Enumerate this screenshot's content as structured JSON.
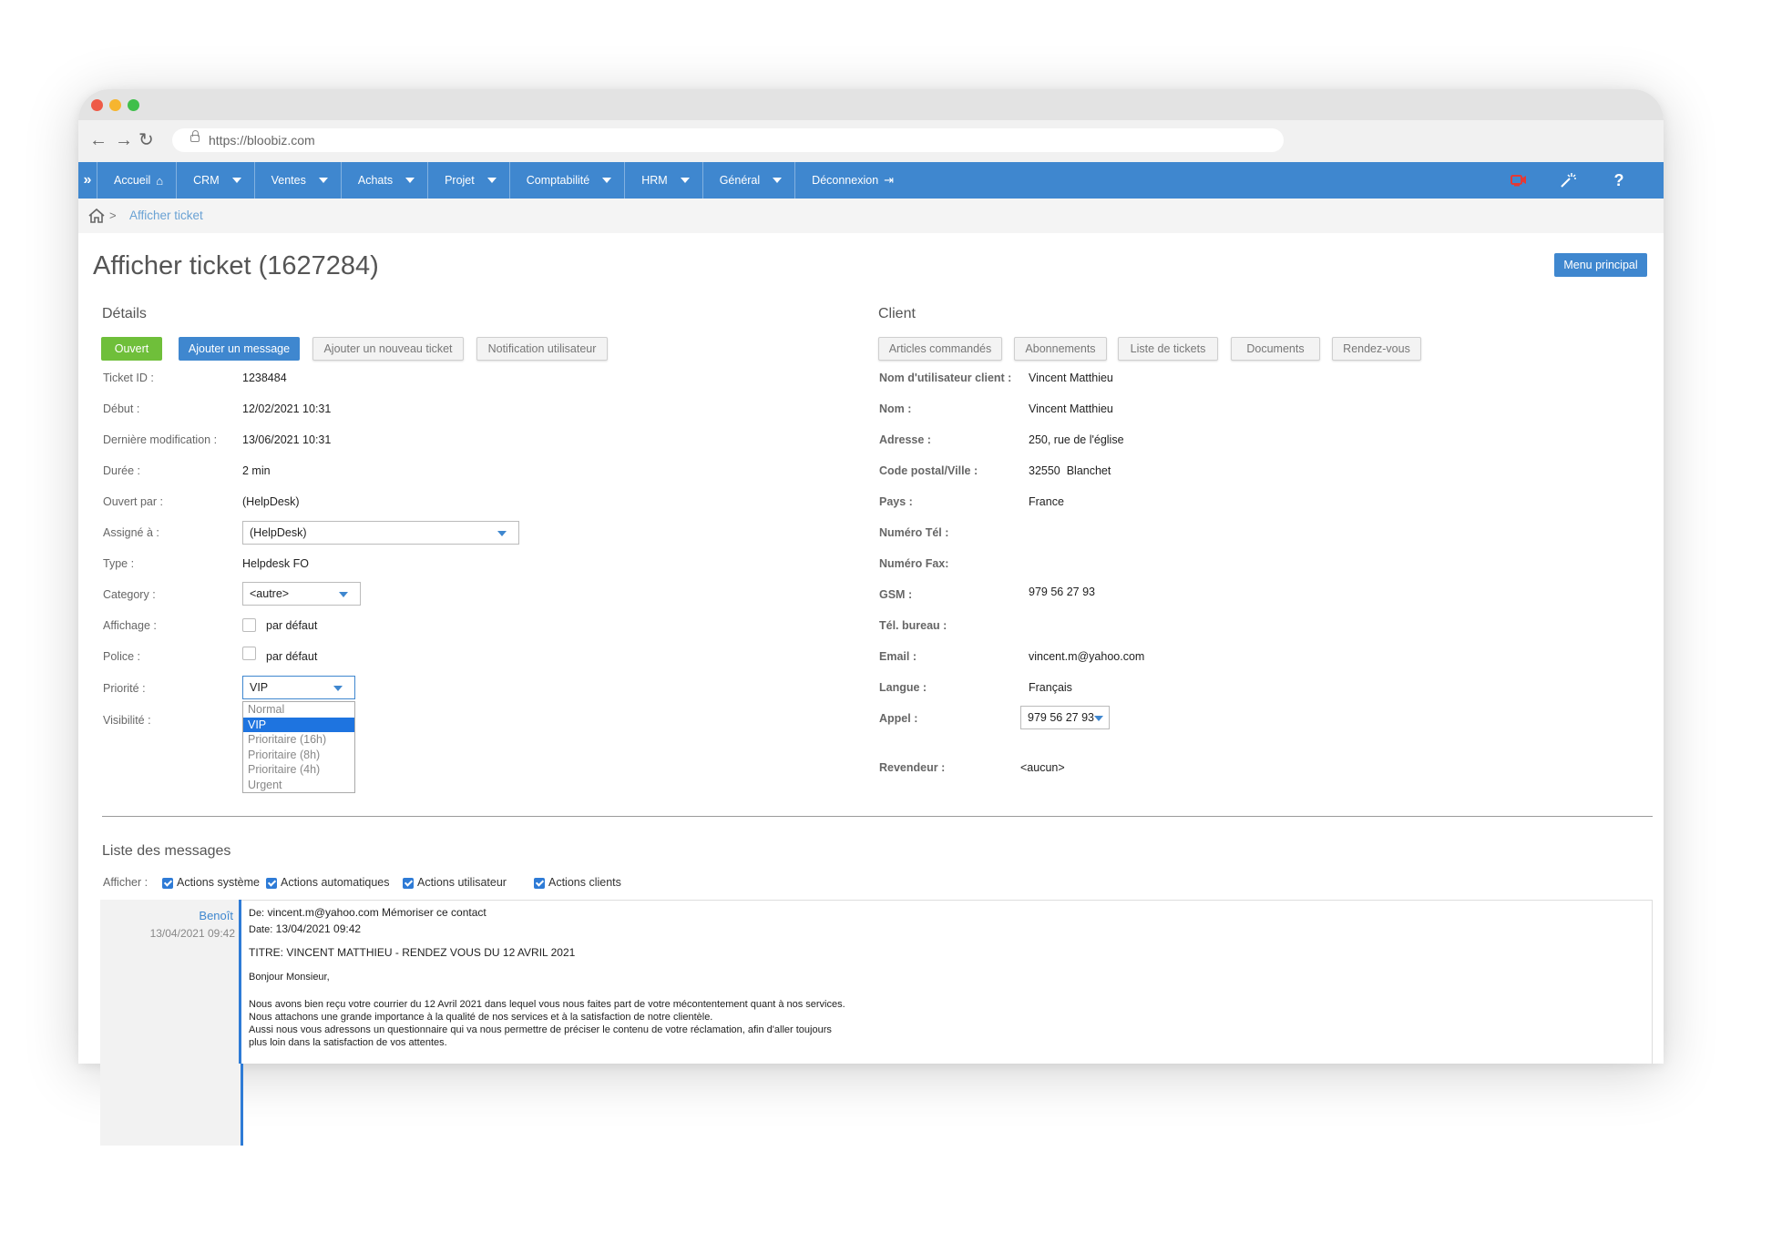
{
  "browser": {
    "url": "https://bloobiz.com",
    "nav": {
      "back": "←",
      "forward": "→",
      "reload": "↻"
    }
  },
  "menu": {
    "expand": "»",
    "items": [
      {
        "label": "Accueil",
        "icon": "home-icon",
        "caret": false
      },
      {
        "label": "CRM",
        "caret": true
      },
      {
        "label": "Ventes",
        "caret": true
      },
      {
        "label": "Achats",
        "caret": true
      },
      {
        "label": "Projet",
        "caret": true
      },
      {
        "label": "Comptabilité",
        "caret": true
      },
      {
        "label": "HRM",
        "caret": true
      },
      {
        "label": "Général",
        "caret": true
      },
      {
        "label": "Déconnexion",
        "icon": "logout-icon",
        "caret": false
      }
    ],
    "right_icons": [
      "video-call-icon",
      "magic-wand-icon",
      "help-icon"
    ],
    "help": "?"
  },
  "breadcrumb": {
    "current": "Afficher ticket",
    "separator": ">"
  },
  "page": {
    "title": "Afficher ticket (1627284)",
    "main_menu_button": "Menu principal"
  },
  "details": {
    "title": "Détails",
    "buttons": {
      "status": "Ouvert",
      "add_message": "Ajouter un message",
      "add_ticket": "Ajouter un nouveau ticket",
      "notify": "Notification utilisateur"
    },
    "fields": {
      "ticket_id": {
        "label": "Ticket ID :",
        "value": "1238484"
      },
      "debut": {
        "label": "Début :",
        "value": "12/02/2021 10:31"
      },
      "last_mod": {
        "label": "Dernière modification :",
        "value": "13/06/2021 10:31"
      },
      "duree": {
        "label": "Durée :",
        "value": "2 min"
      },
      "ouvert_par": {
        "label": "Ouvert par :",
        "value": "(HelpDesk)"
      },
      "assigne": {
        "label": "Assigné à :",
        "value": "(HelpDesk)"
      },
      "type": {
        "label": "Type :",
        "value": "Helpdesk FO"
      },
      "category": {
        "label": "Category :",
        "value": "<autre>"
      },
      "affichage": {
        "label": "Affichage :",
        "value": "par défaut",
        "checked": false
      },
      "police": {
        "label": "Police :",
        "value": "par défaut",
        "checked": false
      },
      "priorite": {
        "label": "Priorité :",
        "value": "VIP"
      },
      "visibilite": {
        "label": "Visibilité :"
      }
    },
    "priority_options": [
      "Normal",
      "VIP",
      "Prioritaire (16h)",
      "Prioritaire (8h)",
      "Prioritaire (4h)",
      "Urgent"
    ],
    "priority_selected": "VIP"
  },
  "client": {
    "title": "Client",
    "buttons": {
      "articles": "Articles commandés",
      "abonnements": "Abonnements",
      "tickets": "Liste de tickets",
      "documents": "Documents",
      "rdv": "Rendez-vous"
    },
    "fields": {
      "username": {
        "label": "Nom d'utilisateur client :",
        "value": "Vincent Matthieu"
      },
      "nom": {
        "label": "Nom :",
        "value": "Vincent Matthieu"
      },
      "adresse": {
        "label": "Adresse :",
        "value": "250, rue de l'église"
      },
      "cp_ville": {
        "label": "Code postal/Ville :",
        "value": "32550  Blanchet"
      },
      "pays": {
        "label": "Pays :",
        "value": "France"
      },
      "tel": {
        "label": "Numéro Tél :",
        "value": ""
      },
      "fax": {
        "label": "Numéro Fax:",
        "value": ""
      },
      "gsm": {
        "label": "GSM :",
        "value": "979 56 27 93"
      },
      "tel_bureau": {
        "label": "Tél. bureau :",
        "value": ""
      },
      "email": {
        "label": "Email :",
        "value": "vincent.m@yahoo.com"
      },
      "langue": {
        "label": "Langue :",
        "value": "Français"
      },
      "appel": {
        "label": "Appel :",
        "value": "979 56 27 93"
      },
      "revendeur": {
        "label": "Revendeur :",
        "value": "<aucun>"
      }
    }
  },
  "messages": {
    "title": "Liste des messages",
    "filter_label": "Afficher :",
    "filters": [
      {
        "label": "Actions système",
        "checked": true
      },
      {
        "label": "Actions automatiques",
        "checked": true
      },
      {
        "label": "Actions utilisateur",
        "checked": true
      },
      {
        "label": "Actions clients",
        "checked": true
      }
    ],
    "items": [
      {
        "author": "Benoît",
        "date": "13/04/2021 09:42",
        "from_label": "De:",
        "from": "vincent.m@yahoo.com Mémoriser ce contact",
        "date_label": "Date:",
        "date_value": "13/04/2021 09:42",
        "subject": "TITRE: VINCENT MATTHIEU - RENDEZ VOUS DU 12 AVRIL 2021",
        "greeting": "Bonjour Monsieur,",
        "body": [
          "Nous avons bien reçu votre courrier du 12 Avril 2021 dans lequel vous nous faites part de votre mécontentement quant à nos services.",
          "Nous attachons une grande importance à la qualité de nos services et à la satisfaction de notre clientèle.",
          "Aussi nous vous adressons un questionnaire qui va nous permettre de  préciser le contenu de votre réclamation, afin d'aller toujours",
          "plus loin dans la satisfaction de vos attentes."
        ]
      }
    ]
  },
  "colors": {
    "accent": "#3f87cf",
    "status_green": "#6fbf3a",
    "selected_option": "#1e74e0",
    "video_icon": "#e53935"
  }
}
